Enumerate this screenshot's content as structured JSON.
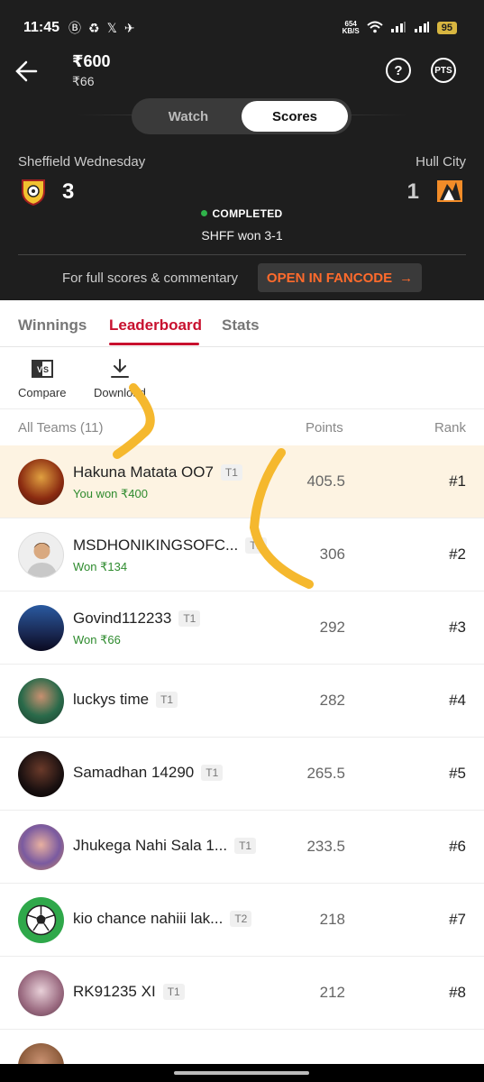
{
  "status_bar": {
    "time": "11:45",
    "data_rate": "654",
    "data_unit": "KB/S",
    "battery": "95"
  },
  "header": {
    "amount": "₹600",
    "sub_amount": "₹66",
    "pts_label": "PTS"
  },
  "toggle": {
    "watch": "Watch",
    "scores": "Scores"
  },
  "match": {
    "team1": "Sheffield Wednesday",
    "score1": "3",
    "team2": "Hull City",
    "score2": "1",
    "status": "COMPLETED",
    "result": "SHFF won 3-1"
  },
  "commentary": {
    "text": "For full scores & commentary",
    "button": "OPEN IN FANCODE"
  },
  "tabs": [
    "Winnings",
    "Leaderboard",
    "Stats"
  ],
  "tools": {
    "compare": "Compare",
    "download": "Download"
  },
  "list_header": {
    "teams": "All Teams (11)",
    "points": "Points",
    "rank": "Rank"
  },
  "rows": [
    {
      "name": "Hakuna Matata OO7",
      "tag": "T1",
      "won": "You won ₹400",
      "points": "405.5",
      "rank": "#1"
    },
    {
      "name": "MSDHONIKINGSOFC...",
      "tag": "T1",
      "won": "Won ₹134",
      "points": "306",
      "rank": "#2"
    },
    {
      "name": "Govind112233",
      "tag": "T1",
      "won": "Won ₹66",
      "points": "292",
      "rank": "#3"
    },
    {
      "name": "luckys time",
      "tag": "T1",
      "won": "",
      "points": "282",
      "rank": "#4"
    },
    {
      "name": "Samadhan 14290",
      "tag": "T1",
      "won": "",
      "points": "265.5",
      "rank": "#5"
    },
    {
      "name": "Jhukega Nahi Sala 1...",
      "tag": "T1",
      "won": "",
      "points": "233.5",
      "rank": "#6"
    },
    {
      "name": "kio chance nahiii lak...",
      "tag": "T2",
      "won": "",
      "points": "218",
      "rank": "#7"
    },
    {
      "name": "RK91235 XI",
      "tag": "T1",
      "won": "",
      "points": "212",
      "rank": "#8"
    }
  ],
  "colors": {
    "accent": "#c8102e",
    "fancode": "#ff6b2c",
    "win": "#2e8b2e",
    "highlight": "#fdf3e2"
  }
}
